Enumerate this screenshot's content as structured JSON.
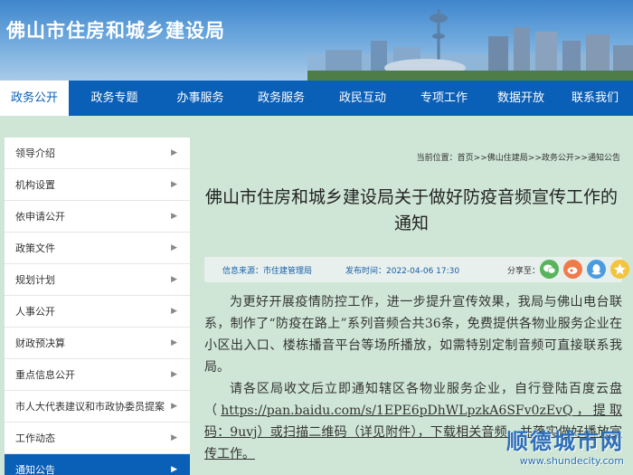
{
  "site": {
    "title": "佛山市住房和城乡建设局"
  },
  "nav": [
    {
      "label": "政务公开",
      "active": true
    },
    {
      "label": "政务专题"
    },
    {
      "label": "办事服务"
    },
    {
      "label": "政务服务"
    },
    {
      "label": "政民互动"
    },
    {
      "label": "专项工作"
    },
    {
      "label": "数据开放"
    },
    {
      "label": "联系我们"
    }
  ],
  "sidebar": {
    "items": [
      {
        "label": "领导介绍"
      },
      {
        "label": "机构设置"
      },
      {
        "label": "依申请公开"
      },
      {
        "label": "政策文件"
      },
      {
        "label": "规划计划"
      },
      {
        "label": "人事公开"
      },
      {
        "label": "财政预决算"
      },
      {
        "label": "重点信息公开"
      },
      {
        "label": "市人大代表建议和市政协委员提案"
      },
      {
        "label": "工作动态"
      },
      {
        "label": "通知公告",
        "active": true
      }
    ]
  },
  "breadcrumb": {
    "prefix": "当前位置：",
    "items": [
      "首页",
      "佛山住建局",
      "政务公开",
      "通知公告"
    ],
    "separator": ">>"
  },
  "article": {
    "title": "佛山市住房和城乡建设局关于做好防疫音频宣传工作的通知",
    "source": "信息来源：市住建管理局",
    "time": "发布时间：2022-04-06 17:30",
    "share_label": "分享至：",
    "paragraph1": "为更好开展疫情防控工作，进一步提升宣传效果，我局与佛山电台联系，制作了“防疫在路上”系列音频合共36条，免费提供各物业服务企业在小区出入口、楼栋播音平台等场所播放，如需特别定制音频可直接联系我局。",
    "paragraph2_a": "请各区局收文后立即通知辖区各物业服务企业，自行登陆百度云盘（",
    "paragraph2_link": "https://pan.baidu.com/s/1EPE6pDhWLpzkA6SFv0zEvQ，提取码：9uvj）或扫描二维码（详见附件），下载相关音频，并落实做好播放宣传工作。"
  },
  "watermark": {
    "logo": "顺德城市网",
    "url": "www.shundecity.com"
  },
  "share_icons": [
    "wechat-icon",
    "weibo-icon",
    "qq-icon",
    "qzone-icon"
  ],
  "colors": {
    "nav": "#0a5fb7",
    "page_bg": "#cfe6d6",
    "meta_text": "#1a5fa8"
  }
}
